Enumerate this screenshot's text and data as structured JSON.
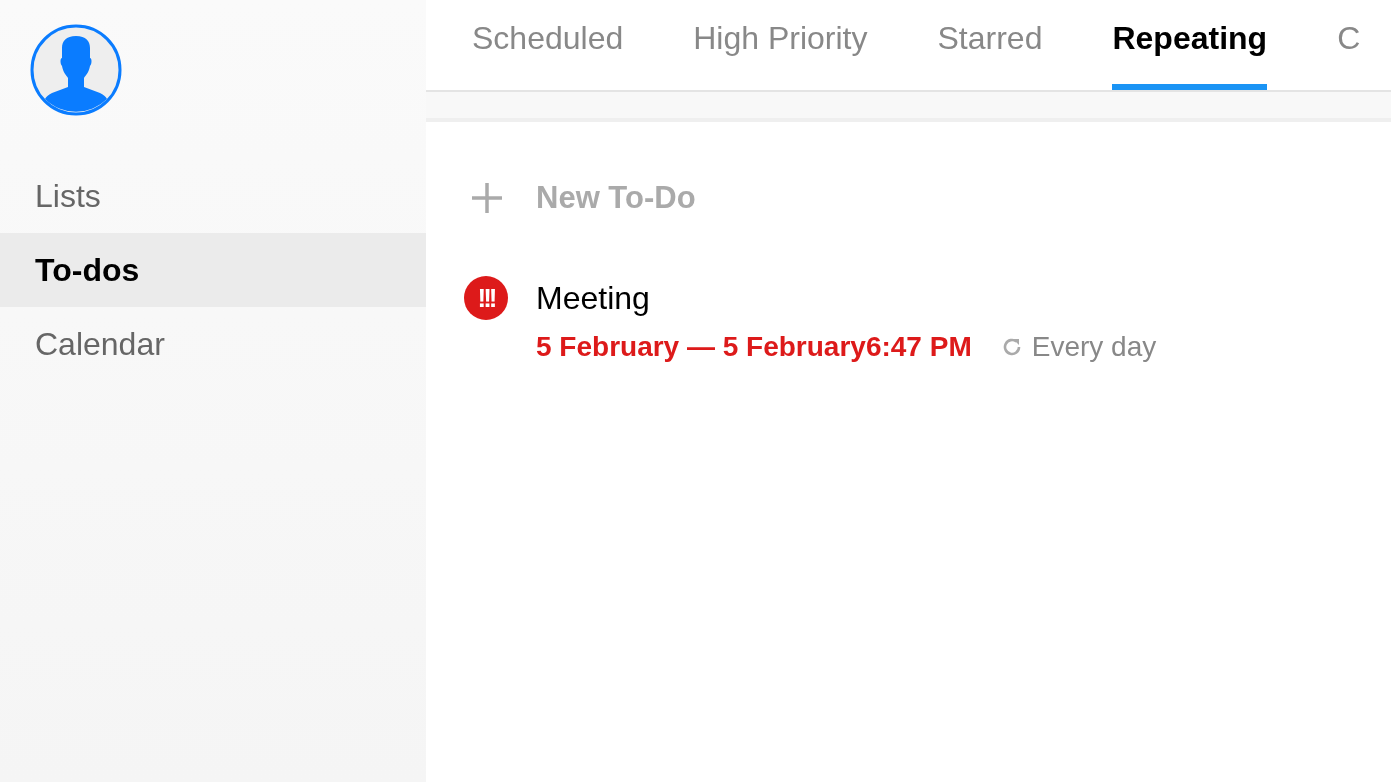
{
  "sidebar": {
    "items": [
      {
        "label": "Lists",
        "selected": false
      },
      {
        "label": "To-dos",
        "selected": true
      },
      {
        "label": "Calendar",
        "selected": false
      }
    ]
  },
  "tabs": [
    {
      "label": "Scheduled",
      "selected": false
    },
    {
      "label": "High Priority",
      "selected": false
    },
    {
      "label": "Starred",
      "selected": false
    },
    {
      "label": "Repeating",
      "selected": true
    },
    {
      "label": "C",
      "selected": false
    }
  ],
  "new_todo": {
    "placeholder": "New To-Do"
  },
  "todos": [
    {
      "priority": "!!!",
      "title": "Meeting",
      "dates": "5 February — 5 February6:47 PM",
      "overdue": true,
      "repeat": "Every day"
    }
  ]
}
